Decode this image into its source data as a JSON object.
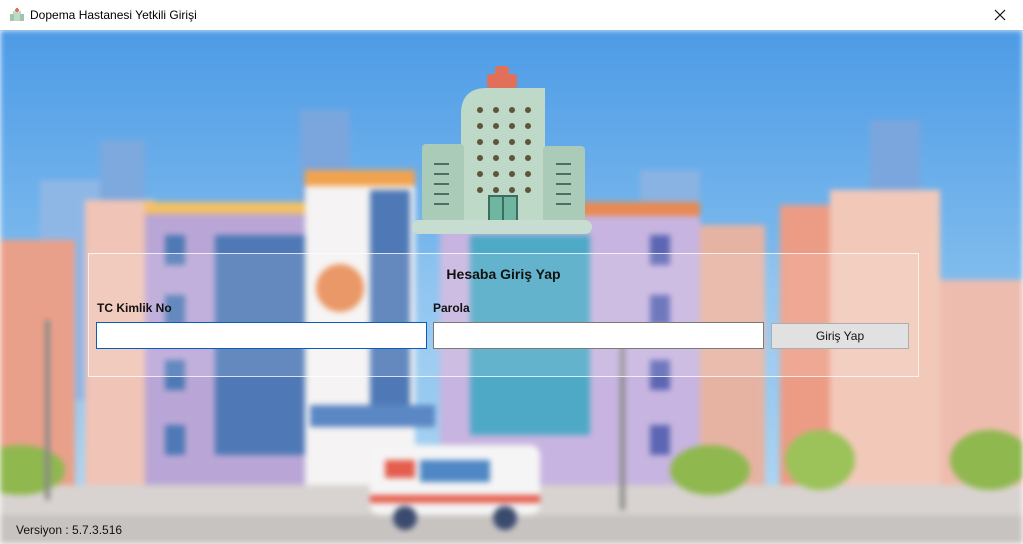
{
  "window": {
    "title": "Dopema Hastanesi Yetkili Girişi",
    "icon": "hospital-icon"
  },
  "login": {
    "heading": "Hesaba Giriş Yap",
    "tc_label": "TC Kimlik No",
    "tc_value": "",
    "password_label": "Parola",
    "password_value": "",
    "submit_label": "Giriş Yap"
  },
  "footer": {
    "version": "Versiyon : 5.7.3.516"
  },
  "colors": {
    "sky": "#5fa6e8",
    "accent": "#0a5db8",
    "cross": "#e1705a"
  }
}
